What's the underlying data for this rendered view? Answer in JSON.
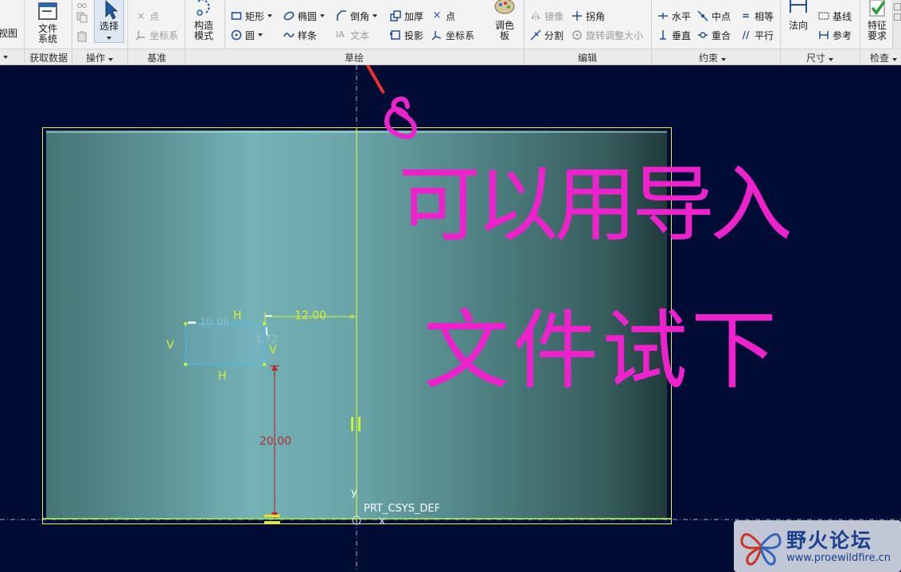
{
  "ribbon": {
    "col0": {
      "label": "视图"
    },
    "file_system": {
      "label_line1": "文件",
      "label_line2": "系统"
    },
    "operations": {
      "cut_label": "",
      "copy_label": "",
      "paste_label": ""
    },
    "select": {
      "label": "选择"
    },
    "datum": {
      "point_label": "点",
      "csys_label": "坐标系"
    },
    "construction_mode": {
      "label_line1": "构造",
      "label_line2": "模式"
    },
    "sketch": {
      "rectangle": "矩形",
      "circle": "圆",
      "ellipse": "椭圆",
      "spline": "样条",
      "chamfer": "倒角",
      "text": "文本",
      "thicken": "加厚",
      "project": "投影",
      "point": "点",
      "csys": "坐标系"
    },
    "palette": {
      "label_line1": "调色",
      "label_line2": "板"
    },
    "edit": {
      "mirror": "镜像",
      "corner": "拐角",
      "divide": "分割",
      "rotate_resize": "旋转调整大小"
    },
    "constrain": {
      "horizontal": "水平",
      "midpoint": "中点",
      "equal": "相等",
      "vertical": "垂直",
      "coincident": "重合",
      "parallel": "平行"
    },
    "dimension": {
      "normal": "法向",
      "baseline": "基线",
      "reference": "参考"
    },
    "feature_req": {
      "label_line1": "特征",
      "label_line2": "要求"
    },
    "groups": {
      "get_data": "获取数据",
      "operations": "操作",
      "datum": "基准",
      "sketch": "草绘",
      "edit": "编辑",
      "constrain": "约束",
      "dimension": "尺寸",
      "inspect": "检查"
    }
  },
  "sketch": {
    "dim_horizontal": "12.00",
    "dim_vertical": "20.00",
    "dim_width_faded": "10.06",
    "dim_height_faded": "4.72",
    "constraint_h_top": "H",
    "constraint_h_bottom": "H",
    "constraint_v_left": "V",
    "constraint_v_right": "V",
    "csys_name": "PRT_CSYS_DEF",
    "axis_y": "y"
  },
  "annotation": {
    "step_number": "8",
    "line1": "可以用导入",
    "line2": "文件试下",
    "color": "#ee22cc"
  },
  "watermark": {
    "title": "野火论坛",
    "url": "www.proewildfire.cn"
  },
  "colors": {
    "canvas_bg": "#000c33",
    "sketch_yellow": "#d7ee32",
    "dim_red": "#b32d2d",
    "sketch_cyan": "#4db8e8"
  }
}
